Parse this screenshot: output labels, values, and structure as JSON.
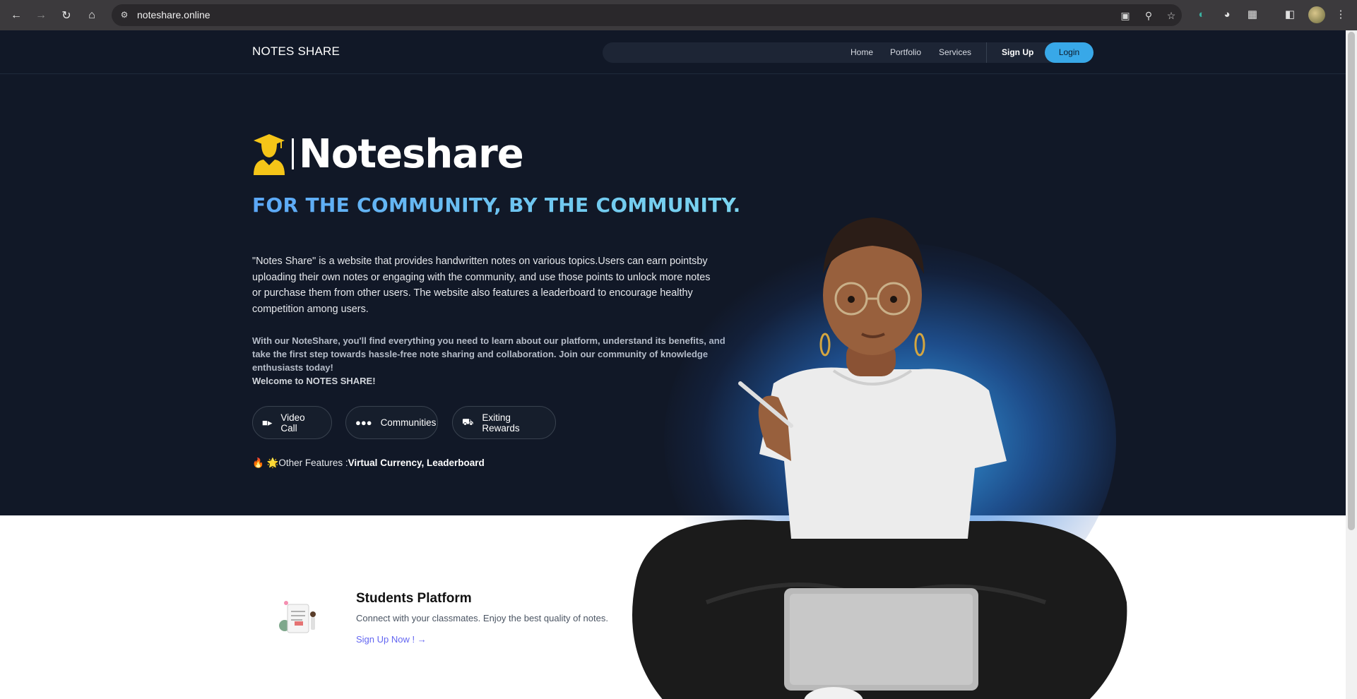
{
  "browser": {
    "url": "noteshare.online",
    "back_icon": "arrow-left-icon",
    "forward_icon": "arrow-right-icon",
    "reload_icon": "reload-icon",
    "home_icon": "home-icon"
  },
  "nav": {
    "brand": "NOTES SHARE",
    "links": [
      "Home",
      "Portfolio",
      "Services"
    ],
    "signup": "Sign Up",
    "login": "Login"
  },
  "hero": {
    "logo_text": "Noteshare",
    "tagline": "FOR THE COMMUNITY, BY THE COMMUNITY.",
    "description": "\"Notes Share\" is a website that provides handwritten notes on various topics.Users can earn pointsby uploading their own notes or engaging with the community, and use those points to unlock more notes or purchase them from other users. The website also features a leaderboard to encourage healthy competition among users.",
    "description2": "With our NoteShare, you'll find everything you need to learn about our platform, understand its benefits, and take the first step towards hassle-free note sharing and collaboration. Join our community of knowledge enthusiasts today!",
    "welcome": "Welcome to NOTES SHARE!",
    "features": [
      {
        "label": "Video Call",
        "icon": "video-camera-icon"
      },
      {
        "label": "Communities",
        "icon": "users-icon"
      },
      {
        "label": "Exiting Rewards",
        "icon": "trophy-icon"
      }
    ],
    "other_prefix": "🔥 🌟Other Features :",
    "other_items": "Virtual Currency,  Leaderboard"
  },
  "platform": {
    "title": "Students Platform",
    "subtitle": "Connect with your classmates. Enjoy the best quality of notes.",
    "link": "Sign Up Now ! →"
  },
  "colors": {
    "hero_bg": "#111827",
    "login_bg": "#38a8e8",
    "tagline": "#5ba7f7",
    "link": "#6366f1"
  }
}
